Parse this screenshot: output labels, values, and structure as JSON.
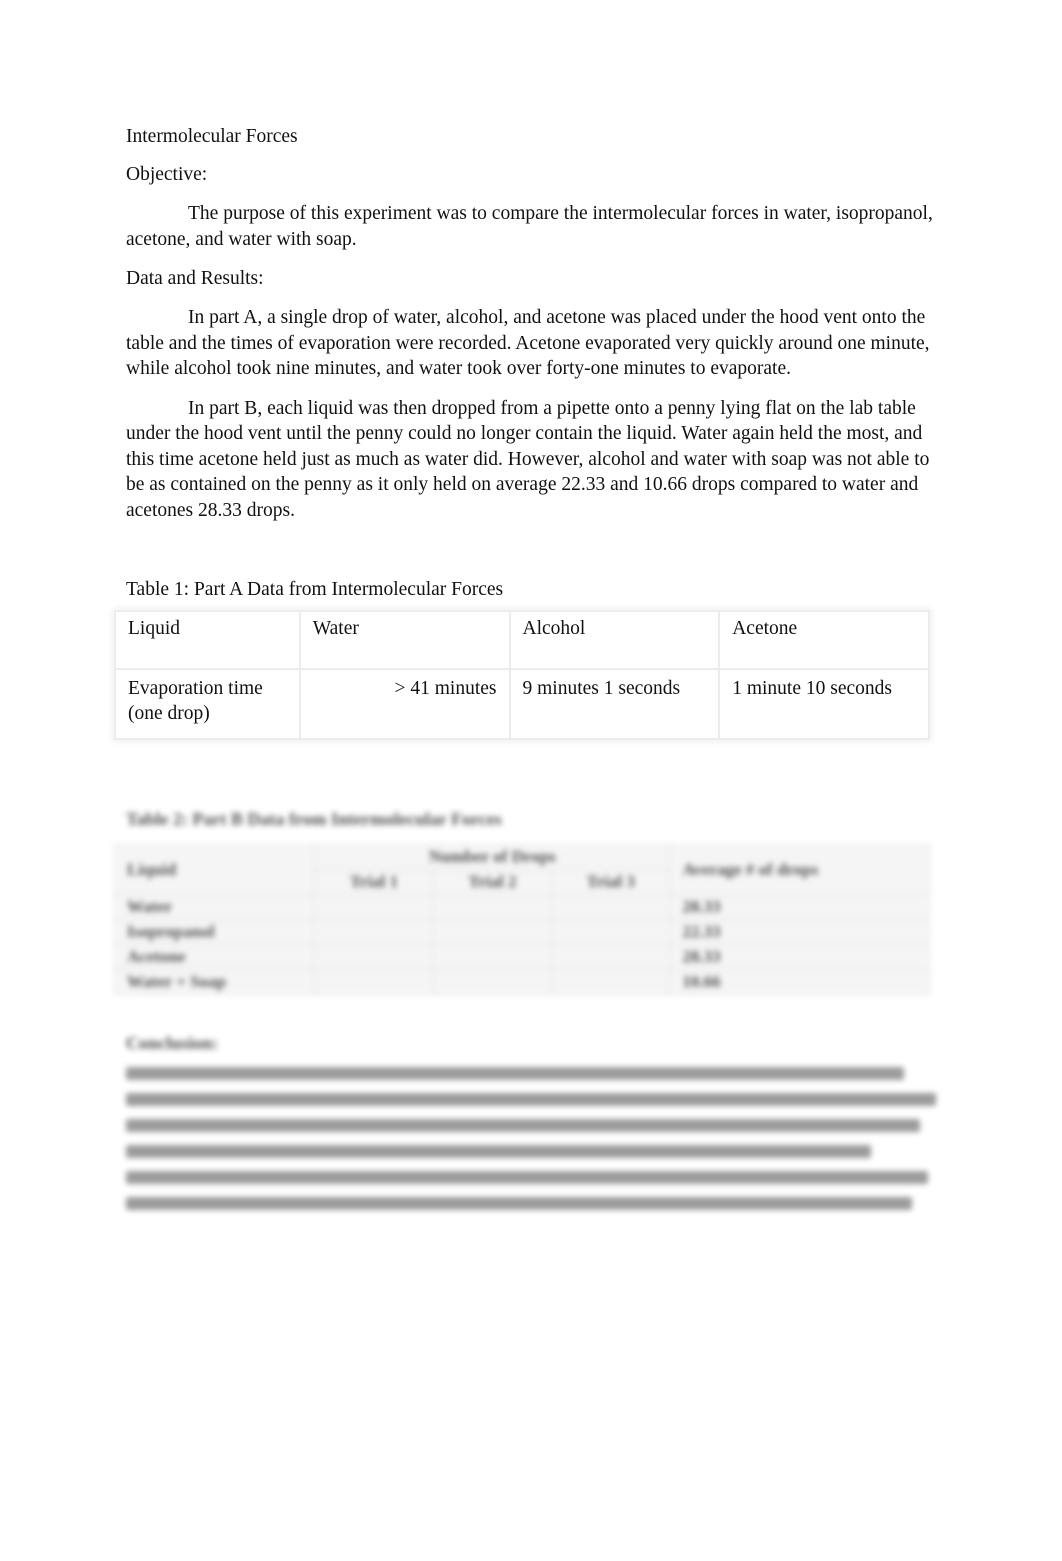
{
  "document": {
    "title": "Intermolecular Forces",
    "objective_heading": "Objective:",
    "objective_text": "The purpose of this experiment was to compare the intermolecular forces in water, isopropanol, acetone, and water with soap.",
    "results_heading": "Data and Results:",
    "part_a_text": "In part A, a single drop of water, alcohol, and acetone was placed under the hood vent onto the table and the times of evaporation were recorded. Acetone evaporated very quickly around one minute, while alcohol took nine minutes, and water took over forty-one minutes to evaporate.",
    "part_b_text": "In part B, each liquid was then dropped from a pipette onto a penny lying flat on the lab table under the hood vent until the penny could no longer contain the liquid. Water again held the most, and this time acetone held just as much as water did. However, alcohol and water with soap was not able to be as contained on the penny as it only held on average 22.33 and 10.66 drops compared to water and acetones 28.33 drops."
  },
  "table1": {
    "caption": "Table 1: Part A Data from Intermolecular Forces",
    "header": [
      "Liquid",
      "Water",
      "Alcohol",
      "Acetone"
    ],
    "row": [
      "Evaporation time (one drop)",
      "> 41 minutes",
      "9 minutes 1 seconds",
      "1 minute 10 seconds"
    ]
  },
  "table2": {
    "caption": "Table 2: Part B Data from Intermolecular Forces",
    "header_liquid": "Liquid",
    "header_group": "Number of Drops",
    "header_avg": "Average # of drops",
    "trials": [
      "Trial 1",
      "Trial 2",
      "Trial 3"
    ],
    "rows": [
      {
        "liquid": "Water",
        "t1": "",
        "t2": "",
        "t3": "",
        "avg": "28.33"
      },
      {
        "liquid": "Isopropanol",
        "t1": "",
        "t2": "",
        "t3": "",
        "avg": "22.33"
      },
      {
        "liquid": "Acetone",
        "t1": "",
        "t2": "",
        "t3": "",
        "avg": "28.33"
      },
      {
        "liquid": "Water + Soap",
        "t1": "",
        "t2": "",
        "t3": "",
        "avg": "10.66"
      }
    ]
  },
  "conclusion": {
    "heading": "Conclusion:"
  }
}
